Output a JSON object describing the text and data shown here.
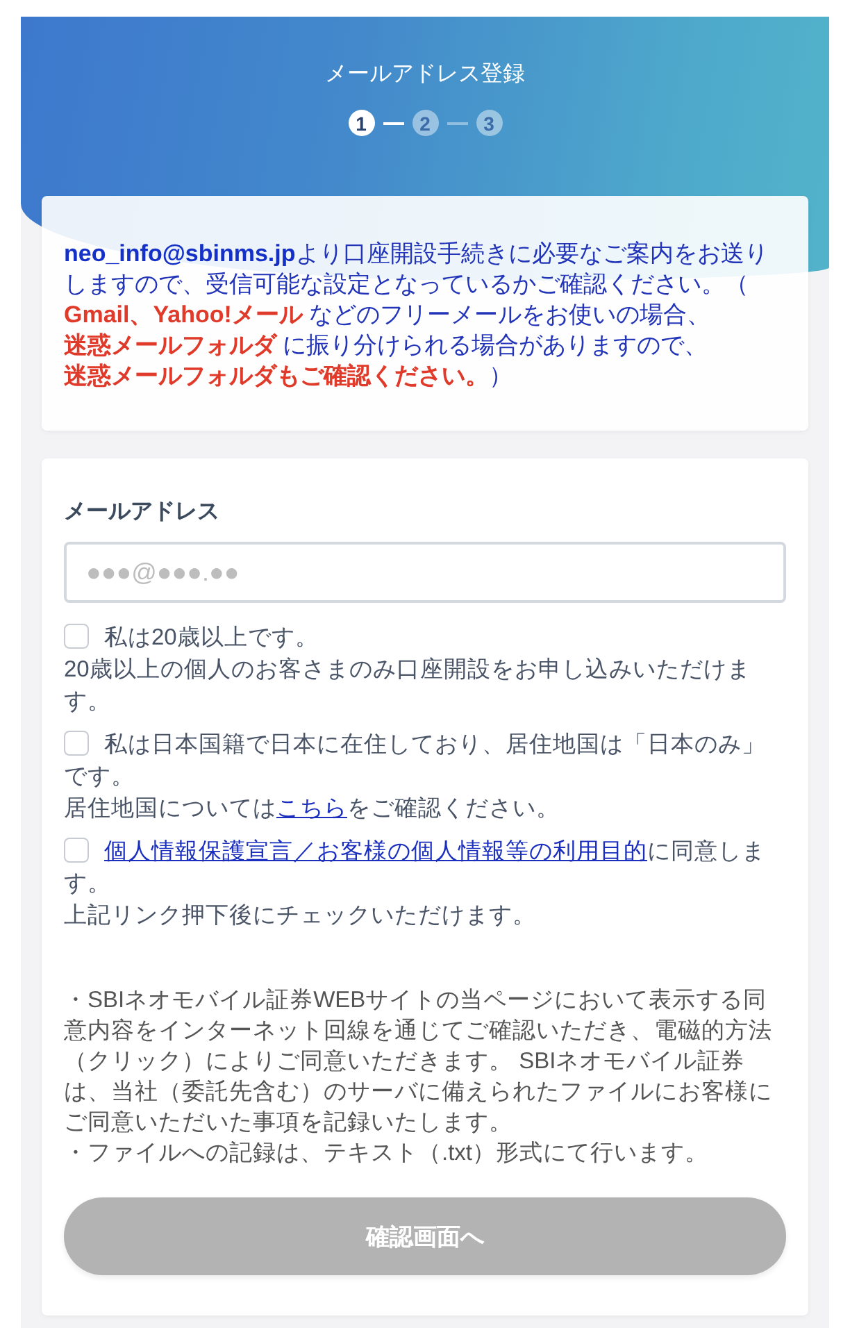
{
  "header": {
    "title": "メールアドレス登録",
    "steps": [
      {
        "label": "1",
        "selected": true
      },
      {
        "label": "2",
        "selected": false
      },
      {
        "label": "3",
        "selected": false
      }
    ]
  },
  "notice": {
    "lines": [
      [
        {
          "kind": "address",
          "text": "neo_info@sbinms.jp"
        },
        {
          "kind": "plain",
          "text": "より口座開設手続きに必要なご案内をお送りしますので、受信可能な設定となっているかご確認ください。（"
        }
      ],
      [
        {
          "kind": "warning",
          "text": "Gmail、Yahoo!メール"
        },
        {
          "kind": "plain",
          "text": " などのフリーメールをお使いの場合、"
        }
      ],
      [
        {
          "kind": "warning",
          "text": "迷惑メールフォルダ"
        },
        {
          "kind": "plain",
          "text": " に振り分けられる場合がありますので、"
        }
      ],
      [
        {
          "kind": "warning",
          "text": "迷惑メールフォルダもご確認ください。"
        },
        {
          "kind": "plain",
          "text": "）"
        }
      ]
    ]
  },
  "form": {
    "email": {
      "label": "メールアドレス",
      "placeholder": "●●●@●●●.●●"
    },
    "consents": [
      {
        "checked": false,
        "text": [
          {
            "kind": "plain",
            "text": "私は20歳以上です。"
          }
        ],
        "note": [
          {
            "kind": "plain",
            "text": "20歳以上の個人のお客さまのみ口座開設をお申し込みいただけます。"
          }
        ]
      },
      {
        "checked": false,
        "text": [
          {
            "kind": "plain",
            "text": "私は日本国籍で日本に在住しており、居住地国は「日本のみ」です。"
          }
        ],
        "note": [
          {
            "kind": "plain",
            "text": "居住地国については"
          },
          {
            "kind": "link",
            "text": "こちら"
          },
          {
            "kind": "plain",
            "text": "をご確認ください。"
          }
        ]
      },
      {
        "checked": false,
        "text": [
          {
            "kind": "link",
            "text": "個人情報保護宣言／お客様の個人情報等の利用目的"
          },
          {
            "kind": "plain",
            "text": "に同意します。"
          }
        ],
        "note": [
          {
            "kind": "plain",
            "text": "上記リンク押下後にチェックいただけます。"
          }
        ]
      }
    ],
    "disclaimer": [
      "・SBIネオモバイル証券WEBサイトの当ページにおいて表示する同意内容をインターネット回線を通じてご確認いただき、電磁的方法（クリック）によりご同意いただきます。 SBIネオモバイル証券は、当社（委託先含む）のサーバに備えられたファイルにお客様にご同意いただいた事項を記録いたします。",
      "・ファイルへの記録は、テキスト（.txt）形式にて行います。"
    ],
    "submit": {
      "label": "確認画面へ",
      "disabled": true
    }
  }
}
